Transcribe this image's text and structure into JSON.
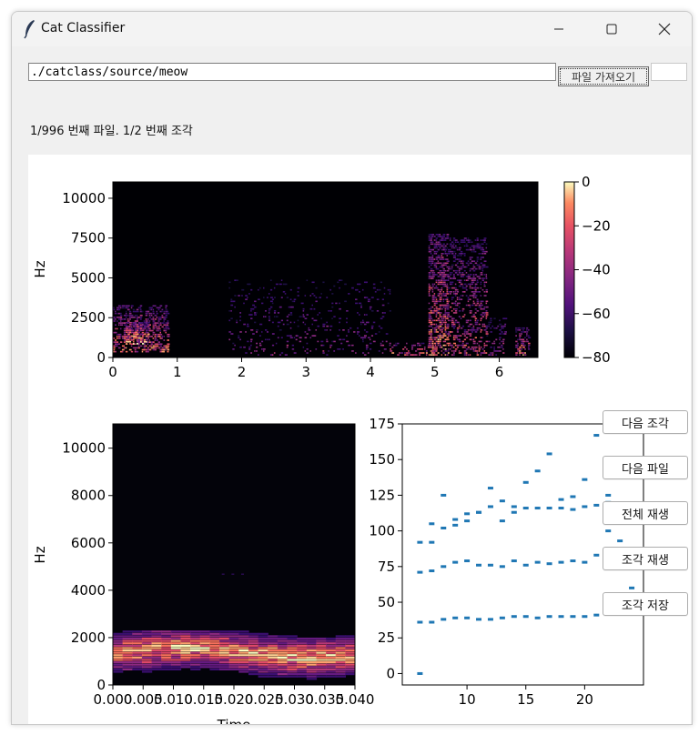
{
  "window": {
    "title": "Cat Classifier",
    "controls": {
      "minimize": "minimize",
      "maximize": "maximize",
      "close": "close"
    },
    "icon": "feather-icon"
  },
  "toolbar": {
    "path_value": "./catclass/source/meow",
    "load_button_label": "파일 가져오기"
  },
  "status": {
    "text": "1/996 번째 파일. 1/2 번째 조각"
  },
  "side_buttons": {
    "next_segment": "다음 조각",
    "next_file": "다음 파일",
    "play_all": "전체 재생",
    "play_segment": "조각 재생",
    "save_segment": "조각 저장"
  },
  "chart_data": [
    {
      "type": "heatmap",
      "title": "",
      "xlabel": "",
      "ylabel": "Hz",
      "xlim": [
        0,
        6.6
      ],
      "ylim": [
        0,
        11025
      ],
      "x_ticks": [
        "0",
        "1",
        "2",
        "3",
        "4",
        "5",
        "6"
      ],
      "y_ticks": [
        "0",
        "2500",
        "5000",
        "7500",
        "10000"
      ],
      "colorbar": {
        "range": [
          -80,
          0
        ],
        "ticks": [
          "0",
          "−20",
          "−40",
          "−60",
          "−80"
        ],
        "colormap": "magma"
      }
    },
    {
      "type": "heatmap",
      "title": "",
      "xlabel": "Time",
      "ylabel": "Hz",
      "xlim": [
        0,
        0.04
      ],
      "ylim": [
        0,
        11025
      ],
      "x_ticks": [
        "0.000",
        "0.005",
        "0.010",
        "0.015",
        "0.020",
        "0.025",
        "0.030",
        "0.035",
        "0.040"
      ],
      "y_ticks": [
        "0",
        "2000",
        "4000",
        "6000",
        "8000",
        "10000"
      ]
    },
    {
      "type": "scatter",
      "title": "",
      "xlabel": "",
      "ylabel": "",
      "xlim": [
        4.5,
        25
      ],
      "ylim": [
        -8,
        175
      ],
      "x_ticks": [
        "10",
        "15",
        "20"
      ],
      "y_ticks": [
        "0",
        "25",
        "50",
        "75",
        "100",
        "125",
        "150",
        "175"
      ],
      "color": "#1f77b4",
      "x": [
        6,
        6,
        6,
        6,
        7,
        7,
        7,
        7,
        8,
        8,
        8,
        8,
        9,
        9,
        9,
        9,
        10,
        10,
        10,
        10,
        11,
        11,
        11,
        11,
        12,
        12,
        12,
        12,
        13,
        13,
        13,
        13,
        14,
        14,
        14,
        14,
        15,
        15,
        15,
        15,
        16,
        16,
        16,
        16,
        17,
        17,
        17,
        17,
        18,
        18,
        18,
        18,
        19,
        19,
        19,
        19,
        20,
        20,
        20,
        20,
        21,
        21,
        21,
        21,
        22,
        22,
        22,
        22,
        23,
        23,
        24
      ],
      "y": [
        0,
        36,
        71,
        92,
        36,
        72,
        92,
        105,
        38,
        75,
        102,
        125,
        39,
        78,
        104,
        108,
        39,
        79,
        107,
        112,
        38,
        76,
        113,
        113,
        38,
        76,
        117,
        130,
        39,
        75,
        107,
        121,
        40,
        79,
        113,
        117,
        40,
        76,
        116,
        134,
        39,
        78,
        116,
        142,
        40,
        77,
        116,
        154,
        40,
        78,
        116,
        122,
        40,
        79,
        115,
        124,
        40,
        78,
        117,
        136,
        41,
        83,
        118,
        167,
        42,
        100,
        120,
        125,
        81,
        93,
        60
      ]
    }
  ]
}
